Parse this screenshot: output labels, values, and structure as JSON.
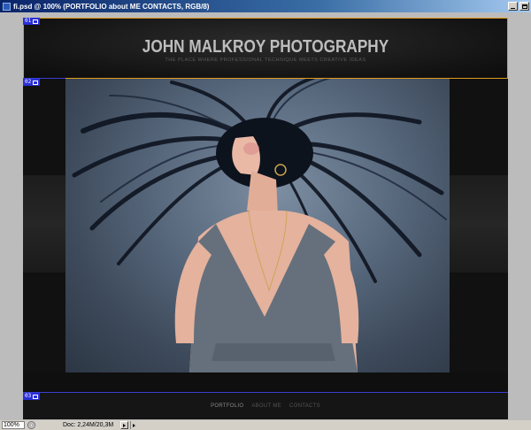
{
  "window": {
    "title": "fi.psd @ 100% (PORTFOLIO     about ME     CONTACTS, RGB/8)"
  },
  "site": {
    "title": "JOHN MALKROY PHOTOGRAPHY",
    "tagline": "THE PLACE WHERE PROFESSIONAL TECHNIQUE MEETS CREATIVE IDEAS",
    "nav": [
      "PORTFOLIO",
      "ABOUT ME",
      "CONTACTS"
    ]
  },
  "slices": [
    "01",
    "02",
    "03"
  ],
  "status": {
    "zoom": "100%",
    "doc": "Doc: 2,24M/20,3M"
  },
  "colors": {
    "slice_border": "#e09a1a",
    "slice_tag": "#2a2fd8",
    "title_bar": "#0a246a"
  }
}
